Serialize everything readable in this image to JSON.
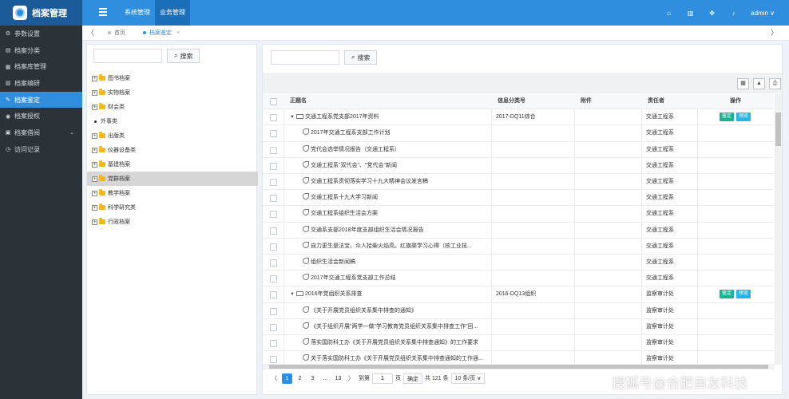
{
  "header": {
    "app_title": "档案管理",
    "nav": [
      {
        "label": "系统管理",
        "active": false
      },
      {
        "label": "业务管理",
        "active": true
      }
    ],
    "user": "admin ∨"
  },
  "sidebar": {
    "items": [
      {
        "label": "参数设置",
        "icon": "gear-icon",
        "glyph": "⚙",
        "active": false
      },
      {
        "label": "档案分类",
        "icon": "document-icon",
        "glyph": "▤",
        "active": false
      },
      {
        "label": "档案库管理",
        "icon": "archive-icon",
        "glyph": "▦",
        "active": false
      },
      {
        "label": "档案编研",
        "icon": "book-icon",
        "glyph": "▥",
        "active": false
      },
      {
        "label": "档案鉴定",
        "icon": "wrench-icon",
        "glyph": "✎",
        "active": true
      },
      {
        "label": "档案授权",
        "icon": "key-icon",
        "glyph": "◉",
        "active": false
      },
      {
        "label": "档案借阅",
        "icon": "borrow-icon",
        "glyph": "▣",
        "active": false,
        "has_caret": true
      },
      {
        "label": "访问记录",
        "icon": "clock-icon",
        "glyph": "◷",
        "active": false
      }
    ]
  },
  "tabs": [
    {
      "label": "首页",
      "active": false
    },
    {
      "label": "档案鉴定",
      "active": true
    }
  ],
  "tree_panel": {
    "search_placeholder": "",
    "search_button": "搜索",
    "nodes": [
      {
        "label": "图书档案",
        "type": "folder",
        "selected": false
      },
      {
        "label": "实物档案",
        "type": "folder",
        "selected": false
      },
      {
        "label": "财会类",
        "type": "folder",
        "selected": false
      },
      {
        "label": "外事类",
        "type": "leaf",
        "selected": false
      },
      {
        "label": "出版类",
        "type": "folder",
        "selected": false
      },
      {
        "label": "仪器设备类",
        "type": "folder",
        "selected": false
      },
      {
        "label": "基建档案",
        "type": "folder",
        "selected": false
      },
      {
        "label": "党群档案",
        "type": "folder",
        "selected": true
      },
      {
        "label": "教学档案",
        "type": "folder",
        "selected": false
      },
      {
        "label": "科学研究类",
        "type": "folder",
        "selected": false
      },
      {
        "label": "行政档案",
        "type": "folder",
        "selected": false
      }
    ]
  },
  "table_panel": {
    "search_placeholder": "",
    "search_button": "搜索",
    "tools": [
      {
        "name": "columns-icon",
        "glyph": "▦"
      },
      {
        "name": "export-icon",
        "glyph": "▲"
      },
      {
        "name": "print-icon",
        "glyph": "⎙"
      }
    ],
    "columns": [
      "正题名",
      "信息分类号",
      "附件",
      "责任者",
      "操作"
    ],
    "rows": [
      {
        "title": "交通工程系党支部2017年资料",
        "group": true,
        "code": "2017-DQ11综合",
        "attach": "",
        "owner": "交通工程系",
        "actions": [
          "鉴定",
          "预览"
        ]
      },
      {
        "title": "2017年交通工程系支部工作计划",
        "group": false,
        "code": "",
        "attach": "",
        "owner": "交通工程系",
        "actions": []
      },
      {
        "title": "党代会选举情况报告（交通工程系）",
        "group": false,
        "code": "",
        "attach": "",
        "owner": "交通工程系",
        "actions": []
      },
      {
        "title": "交通工程系\"双代会\"、\"党代会\"新闻",
        "group": false,
        "code": "",
        "attach": "",
        "owner": "交通工程系",
        "actions": []
      },
      {
        "title": "交通工程系贯彻落实学习十九大精神会议发言稿",
        "group": false,
        "code": "",
        "attach": "",
        "owner": "交通工程系",
        "actions": []
      },
      {
        "title": "交通工程系十九大学习新闻",
        "group": false,
        "code": "",
        "attach": "",
        "owner": "交通工程系",
        "actions": []
      },
      {
        "title": "交通工程系组织生活会方案",
        "group": false,
        "code": "",
        "attach": "",
        "owner": "交通工程系",
        "actions": []
      },
      {
        "title": "交通系支部2018年度支部组织生活会情况报告",
        "group": false,
        "code": "",
        "attach": "",
        "owner": "交通工程系",
        "actions": []
      },
      {
        "title": "自力更生是法宝，众人拾柴火焰高。红旗渠学习心得（核工业技...",
        "group": false,
        "code": "",
        "attach": "",
        "owner": "交通工程系",
        "actions": []
      },
      {
        "title": "组织生活会新闻稿",
        "group": false,
        "code": "",
        "attach": "",
        "owner": "交通工程系",
        "actions": []
      },
      {
        "title": "2017年交通工程系党支部工作总结",
        "group": false,
        "code": "",
        "attach": "",
        "owner": "交通工程系",
        "actions": []
      },
      {
        "title": "2016年党组织关系排查",
        "group": true,
        "code": "2016-DQ13组织",
        "attach": "",
        "owner": "监察审计处",
        "actions": [
          "鉴定",
          "预览"
        ]
      },
      {
        "title": "《关于开展党员组织关系集中排查的通知》",
        "group": false,
        "code": "",
        "attach": "",
        "owner": "监察审计处",
        "actions": []
      },
      {
        "title": "《关于组织开展\"两学一做\"学习教育党员组织关系集中排查工作\"回...",
        "group": false,
        "code": "",
        "attach": "",
        "owner": "监察审计处",
        "actions": []
      },
      {
        "title": "落实国防科工办《关于开展党员组织关系集中排查通知》的工作要求",
        "group": false,
        "code": "",
        "attach": "",
        "owner": "监察审计处",
        "actions": []
      },
      {
        "title": "关于落实国防科工办《关于开展党员组织关系集中排查通知的工作通...",
        "group": false,
        "code": "",
        "attach": "",
        "owner": "监察审计处",
        "actions": []
      }
    ],
    "pager": {
      "prev": "〈",
      "pages": [
        "1",
        "2",
        "3",
        "...",
        "13"
      ],
      "active_page": "1",
      "next": "〉",
      "goto_label": "到第",
      "goto_value": "1",
      "page_unit": "页",
      "confirm": "确定",
      "total": "共 121 条",
      "page_size": "10 条/页 ∨"
    }
  },
  "watermark": "搜狐号@合肥自友科技"
}
